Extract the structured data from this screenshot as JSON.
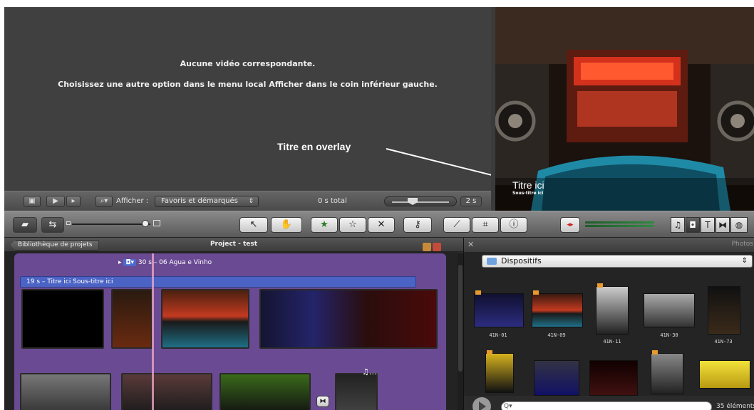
{
  "event_browser": {
    "message_line1": "Aucune vidéo correspondante.",
    "message_line2": "Choisissez une autre option dans le menu local Afficher dans le coin inférieur gauche.",
    "annotation": "Titre en overlay",
    "afficher_label": "Afficher :",
    "afficher_value": "Favoris et démarqués",
    "total": "0 s total",
    "duration": "2 s"
  },
  "viewer": {
    "overlay_title": "Titre ici",
    "overlay_subtitle": "Sous-titre ici"
  },
  "toolbar": {
    "tools": [
      "select-arrow",
      "crop-frame",
      "favorite-star",
      "unfavorite-star",
      "reject-x",
      "keyword",
      "voiceover-mic",
      "crop",
      "info"
    ],
    "browser_tabs": [
      "music-note",
      "camera",
      "T",
      "transitions",
      "globe"
    ]
  },
  "project": {
    "library_button": "Bibliothèque de projets",
    "title": "Project - test",
    "music_tag": "30 s",
    "music_label": "30 s – 06 Agua e Vinho",
    "title_clip": "19 s – Titre ici Sous-titre ici",
    "note": "♫…"
  },
  "photos": {
    "header": "Photos",
    "source": "Dispositifs",
    "row1": [
      "41N-01",
      "41N-09",
      "41N-11",
      "41N-30",
      "41N-73"
    ],
    "search_placeholder": "Q▾",
    "count": "35 éléments"
  }
}
